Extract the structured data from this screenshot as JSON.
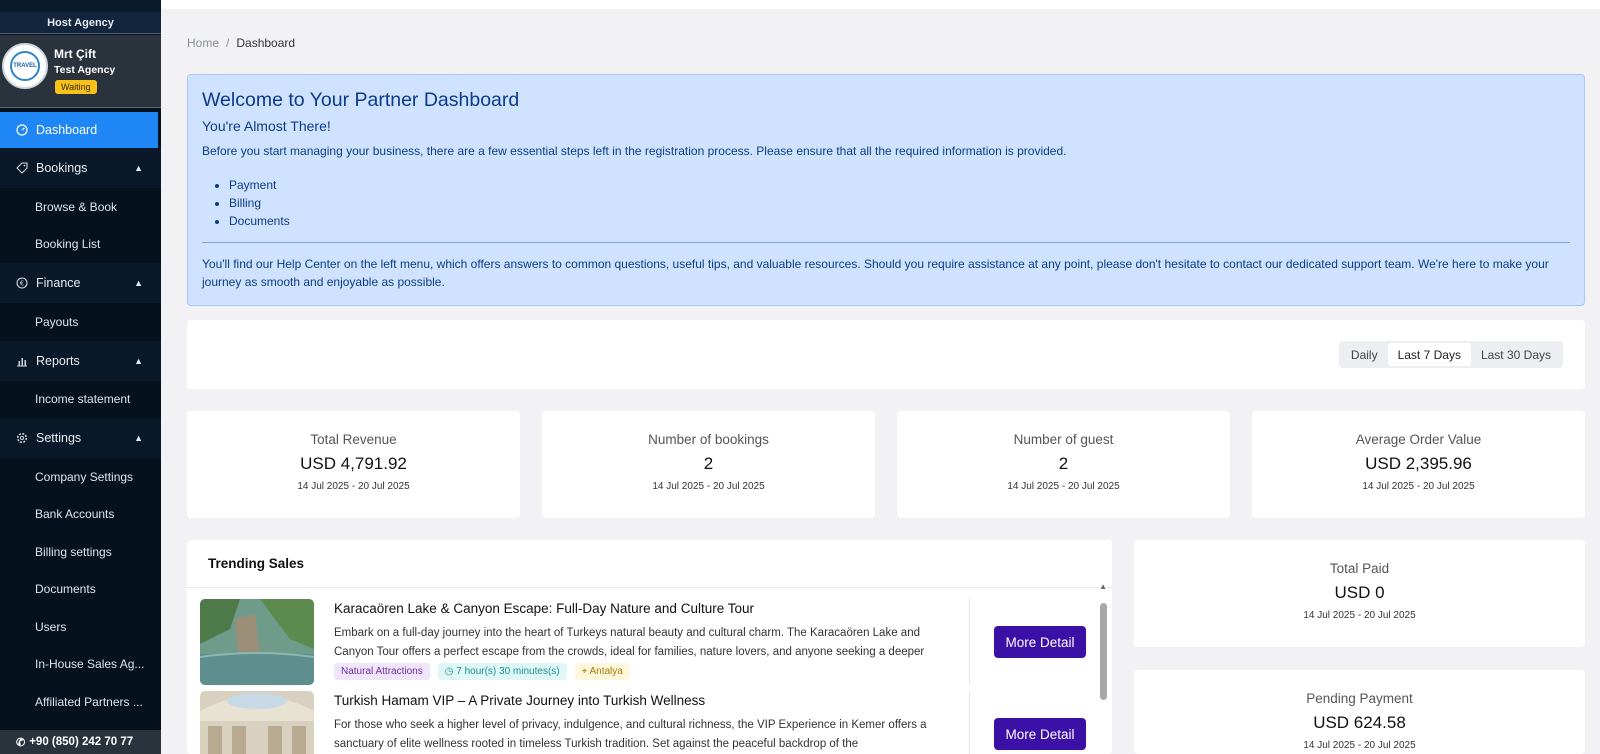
{
  "sidebar": {
    "agency_label": "Host Agency",
    "profile": {
      "name": "Mrt Çift",
      "agency": "Test Agency",
      "status": "Waiting",
      "avatar_text": "TRAVEL"
    },
    "nav": {
      "dashboard": "Dashboard",
      "bookings": "Bookings",
      "browse_book": "Browse & Book",
      "booking_list": "Booking List",
      "finance": "Finance",
      "payouts": "Payouts",
      "reports": "Reports",
      "income_statement": "Income statement",
      "settings": "Settings",
      "company_settings": "Company Settings",
      "bank_accounts": "Bank Accounts",
      "billing_settings": "Billing settings",
      "documents": "Documents",
      "users": "Users",
      "in_house": "In-House Sales Ag...",
      "affiliated": "Affiliated Partners ..."
    },
    "phone": "+90 (850) 242 70 77"
  },
  "breadcrumb": {
    "home": "Home",
    "sep": "/",
    "current": "Dashboard"
  },
  "welcome": {
    "title": "Welcome to Your Partner Dashboard",
    "subtitle": "You're Almost There!",
    "intro": "Before you start managing your business, there are a few essential steps left in the registration process. Please ensure that all the required information is provided.",
    "steps": [
      "Payment",
      "Billing",
      "Documents"
    ],
    "help": "You'll find our Help Center on the left menu, which offers answers to common questions, useful tips, and valuable resources. Should you require assistance at any point, please don't hesitate to contact our dedicated support team. We're here to make your journey as smooth and enjoyable as possible."
  },
  "filters": {
    "options": [
      "Daily",
      "Last 7 Days",
      "Last 30 Days"
    ],
    "selected": "Last 7 Days"
  },
  "stats": [
    {
      "label": "Total Revenue",
      "value": "USD 4,791.92",
      "range": "14 Jul 2025 - 20 Jul 2025"
    },
    {
      "label": "Number of bookings",
      "value": "2",
      "range": "14 Jul 2025 - 20 Jul 2025"
    },
    {
      "label": "Number of guest",
      "value": "2",
      "range": "14 Jul 2025 - 20 Jul 2025"
    },
    {
      "label": "Average Order Value",
      "value": "USD 2,395.96",
      "range": "14 Jul 2025 - 20 Jul 2025"
    }
  ],
  "trending": {
    "title": "Trending Sales",
    "button_label": "More Detail",
    "items": [
      {
        "title": "Karacaören Lake & Canyon Escape: Full-Day Nature and Culture Tour",
        "desc": "Embark on a full-day journey into the heart of Turkeys natural beauty and cultural charm. The Karacaören Lake and Canyon Tour offers a perfect escape from the crowds, ideal for families, nature lovers, and anyone seeking a deeper",
        "category": "Natural Attractions",
        "duration": "7 hour(s) 30 minutes(s)",
        "location": "Antalya"
      },
      {
        "title": "Turkish Hamam VIP – A Private Journey into Turkish Wellness",
        "desc": "For those who seek a higher level of privacy, indulgence, and cultural richness, the VIP Experience in Kemer offers a sanctuary of elite wellness rooted in timeless Turkish tradition. Set against the peaceful backdrop of the"
      }
    ]
  },
  "side_stats": [
    {
      "label": "Total Paid",
      "value": "USD 0",
      "range": "14 Jul 2025 - 20 Jul 2025"
    },
    {
      "label": "Pending Payment",
      "value": "USD 624.58",
      "range": "14 Jul 2025 - 20 Jul 2025"
    }
  ],
  "colors": {
    "active_nav": "#1e86f5",
    "sidebar_bg": "#06111e",
    "welcome_bg": "#cfe2ff",
    "primary_button": "#3b10a6"
  }
}
